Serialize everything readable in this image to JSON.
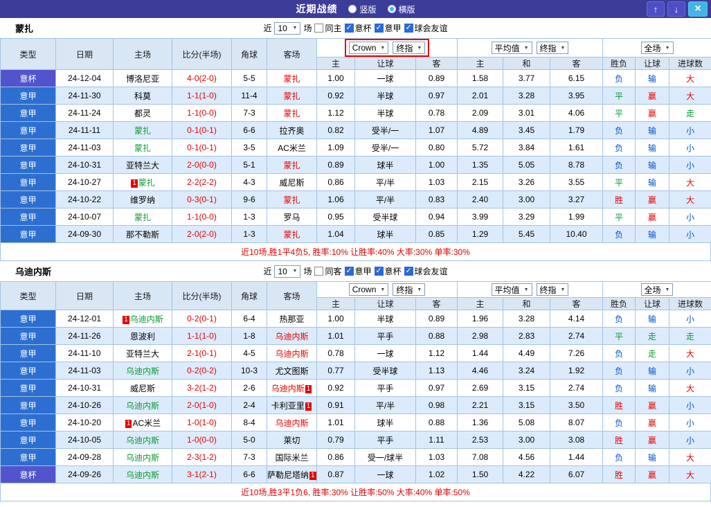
{
  "top_bar": {
    "title": "近期战绩",
    "radios": [
      {
        "label": "竖版",
        "selected": false
      },
      {
        "label": "横版",
        "selected": true
      }
    ]
  },
  "icons": {
    "caret": "▼",
    "up": "↑",
    "down": "↓",
    "close": "×",
    "check": "✓"
  },
  "colors": {
    "league_bg": "#2d6fd1",
    "cup_bg": "#5254ce",
    "win_red": "#e60000",
    "lose_blue": "#0052cc",
    "draw_green": "#0a9a32",
    "topbar_bg": "#3c3c99"
  },
  "columns": [
    "类型",
    "日期",
    "主场",
    "比分(半场)",
    "角球",
    "客场",
    "主",
    "让球",
    "客",
    "主",
    "和",
    "客",
    "胜负",
    "让球",
    "进球数"
  ],
  "sections": [
    {
      "team": "蒙扎",
      "filter": {
        "near": "近",
        "count": "10",
        "games": "场",
        "same": {
          "label": "同主",
          "checked": false
        },
        "comps": [
          {
            "label": "意杯",
            "checked": true
          },
          {
            "label": "意甲",
            "checked": true
          },
          {
            "label": "球会友谊",
            "checked": true
          }
        ]
      },
      "dropdowns": {
        "company": "Crown",
        "index1": "终指",
        "average": "平均值",
        "index2": "终指",
        "scope": "全场",
        "highlight": true
      },
      "rows": [
        {
          "comp": "意杯",
          "date": "24-12-04",
          "home": "博洛尼亚",
          "score": "4-0(2-0)",
          "corners": "5-5",
          "away": "蒙扎",
          "away_color": "red",
          "o1": "1.00",
          "line": "一球",
          "o2": "0.89",
          "e1": "1.58",
          "e2": "3.77",
          "e3": "6.15",
          "r1": "负",
          "r1_color": "blue",
          "r2": "输",
          "r2_color": "blue",
          "r3": "大",
          "r3_color": "red"
        },
        {
          "comp": "意甲",
          "date": "24-11-30",
          "home": "科莫",
          "score": "1-1(1-0)",
          "corners": "11-4",
          "away": "蒙扎",
          "away_color": "red",
          "o1": "0.92",
          "line": "半球",
          "o2": "0.97",
          "e1": "2.01",
          "e2": "3.28",
          "e3": "3.95",
          "r1": "平",
          "r1_color": "green",
          "r2": "赢",
          "r2_color": "red",
          "r3": "大",
          "r3_color": "red"
        },
        {
          "comp": "意甲",
          "date": "24-11-24",
          "home": "都灵",
          "score": "1-1(0-0)",
          "corners": "7-3",
          "away": "蒙扎",
          "away_color": "red",
          "o1": "1.12",
          "line": "半球",
          "o2": "0.78",
          "e1": "2.09",
          "e2": "3.01",
          "e3": "4.06",
          "r1": "平",
          "r1_color": "green",
          "r2": "赢",
          "r2_color": "red",
          "r3": "走",
          "r3_color": "green"
        },
        {
          "comp": "意甲",
          "date": "24-11-11",
          "home": "蒙扎",
          "home_color": "green",
          "score": "0-1(0-1)",
          "corners": "6-6",
          "away": "拉齐奥",
          "o1": "0.82",
          "line": "受半/一",
          "o2": "1.07",
          "e1": "4.89",
          "e2": "3.45",
          "e3": "1.79",
          "r1": "负",
          "r1_color": "blue",
          "r2": "输",
          "r2_color": "blue",
          "r3": "小",
          "r3_color": "blue"
        },
        {
          "comp": "意甲",
          "date": "24-11-03",
          "home": "蒙扎",
          "home_color": "green",
          "score": "0-1(0-1)",
          "corners": "3-5",
          "away": "AC米兰",
          "o1": "1.09",
          "line": "受半/一",
          "o2": "0.80",
          "e1": "5.72",
          "e2": "3.84",
          "e3": "1.61",
          "r1": "负",
          "r1_color": "blue",
          "r2": "输",
          "r2_color": "blue",
          "r3": "小",
          "r3_color": "blue"
        },
        {
          "comp": "意甲",
          "date": "24-10-31",
          "home": "亚特兰大",
          "score": "2-0(0-0)",
          "corners": "5-1",
          "away": "蒙扎",
          "away_color": "red",
          "o1": "0.89",
          "line": "球半",
          "o2": "1.00",
          "e1": "1.35",
          "e2": "5.05",
          "e3": "8.78",
          "r1": "负",
          "r1_color": "blue",
          "r2": "输",
          "r2_color": "blue",
          "r3": "小",
          "r3_color": "blue"
        },
        {
          "comp": "意甲",
          "date": "24-10-27",
          "home": "蒙扎",
          "home_color": "green",
          "home_badge_pre": "1",
          "score": "2-2(2-2)",
          "corners": "4-3",
          "away": "威尼斯",
          "o1": "0.86",
          "line": "平/半",
          "o2": "1.03",
          "e1": "2.15",
          "e2": "3.26",
          "e3": "3.55",
          "r1": "平",
          "r1_color": "green",
          "r2": "输",
          "r2_color": "blue",
          "r3": "大",
          "r3_color": "red"
        },
        {
          "comp": "意甲",
          "date": "24-10-22",
          "home": "维罗纳",
          "score": "0-3(0-1)",
          "corners": "9-6",
          "away": "蒙扎",
          "away_color": "red",
          "o1": "1.06",
          "line": "平/半",
          "o2": "0.83",
          "e1": "2.40",
          "e2": "3.00",
          "e3": "3.27",
          "r1": "胜",
          "r1_color": "red",
          "r2": "赢",
          "r2_color": "red",
          "r3": "大",
          "r3_color": "red"
        },
        {
          "comp": "意甲",
          "date": "24-10-07",
          "home": "蒙扎",
          "home_color": "green",
          "score": "1-1(0-0)",
          "corners": "1-3",
          "away": "罗马",
          "o1": "0.95",
          "line": "受半球",
          "o2": "0.94",
          "e1": "3.99",
          "e2": "3.29",
          "e3": "1.99",
          "r1": "平",
          "r1_color": "green",
          "r2": "赢",
          "r2_color": "red",
          "r3": "小",
          "r3_color": "blue"
        },
        {
          "comp": "意甲",
          "date": "24-09-30",
          "home": "那不勒斯",
          "score": "2-0(2-0)",
          "corners": "1-3",
          "away": "蒙扎",
          "away_color": "red",
          "o1": "1.04",
          "line": "球半",
          "o2": "0.85",
          "e1": "1.29",
          "e2": "5.45",
          "e3": "10.40",
          "r1": "负",
          "r1_color": "blue",
          "r2": "输",
          "r2_color": "blue",
          "r3": "小",
          "r3_color": "blue"
        }
      ],
      "summary": "近10场,胜1平4负5, 胜率:10% 让胜率:40% 大率:30% 单率:30%"
    },
    {
      "team": "乌迪内斯",
      "filter": {
        "near": "近",
        "count": "10",
        "games": "场",
        "same": {
          "label": "同客",
          "checked": false
        },
        "comps": [
          {
            "label": "意甲",
            "checked": true
          },
          {
            "label": "意杯",
            "checked": true
          },
          {
            "label": "球会友谊",
            "checked": true
          }
        ]
      },
      "dropdowns": {
        "company": "Crown",
        "index1": "终指",
        "average": "平均值",
        "index2": "终指",
        "scope": "全场",
        "highlight": false
      },
      "rows": [
        {
          "comp": "意甲",
          "date": "24-12-01",
          "home": "乌迪内斯",
          "home_color": "green",
          "home_badge_pre": "1",
          "score": "0-2(0-1)",
          "corners": "6-4",
          "away": "热那亚",
          "o1": "1.00",
          "line": "半球",
          "o2": "0.89",
          "e1": "1.96",
          "e2": "3.28",
          "e3": "4.14",
          "r1": "负",
          "r1_color": "blue",
          "r2": "输",
          "r2_color": "blue",
          "r3": "小",
          "r3_color": "blue"
        },
        {
          "comp": "意甲",
          "date": "24-11-26",
          "home": "恩波利",
          "score": "1-1(1-0)",
          "corners": "1-8",
          "away": "乌迪内斯",
          "away_color": "red",
          "o1": "1.01",
          "line": "平手",
          "o2": "0.88",
          "e1": "2.98",
          "e2": "2.83",
          "e3": "2.74",
          "r1": "平",
          "r1_color": "green",
          "r2": "走",
          "r2_color": "green",
          "r3": "走",
          "r3_color": "green"
        },
        {
          "comp": "意甲",
          "date": "24-11-10",
          "home": "亚特兰大",
          "score": "2-1(0-1)",
          "corners": "4-5",
          "away": "乌迪内斯",
          "away_color": "red",
          "o1": "0.78",
          "line": "一球",
          "o2": "1.12",
          "e1": "1.44",
          "e2": "4.49",
          "e3": "7.26",
          "r1": "负",
          "r1_color": "blue",
          "r2": "走",
          "r2_color": "green",
          "r3": "大",
          "r3_color": "red"
        },
        {
          "comp": "意甲",
          "date": "24-11-03",
          "home": "乌迪内斯",
          "home_color": "green",
          "score": "0-2(0-2)",
          "corners": "10-3",
          "away": "尤文图斯",
          "o1": "0.77",
          "line": "受半球",
          "o2": "1.13",
          "e1": "4.46",
          "e2": "3.24",
          "e3": "1.92",
          "r1": "负",
          "r1_color": "blue",
          "r2": "输",
          "r2_color": "blue",
          "r3": "小",
          "r3_color": "blue"
        },
        {
          "comp": "意甲",
          "date": "24-10-31",
          "home": "威尼斯",
          "score": "3-2(1-2)",
          "corners": "2-6",
          "away": "乌迪内斯",
          "away_color": "red",
          "away_badge_post": "1",
          "o1": "0.92",
          "line": "平手",
          "o2": "0.97",
          "e1": "2.69",
          "e2": "3.15",
          "e3": "2.74",
          "r1": "负",
          "r1_color": "blue",
          "r2": "输",
          "r2_color": "blue",
          "r3": "大",
          "r3_color": "red"
        },
        {
          "comp": "意甲",
          "date": "24-10-26",
          "home": "乌迪内斯",
          "home_color": "green",
          "score": "2-0(1-0)",
          "corners": "2-4",
          "away": "卡利亚里",
          "away_badge_post": "1",
          "o1": "0.91",
          "line": "平/半",
          "o2": "0.98",
          "e1": "2.21",
          "e2": "3.15",
          "e3": "3.50",
          "r1": "胜",
          "r1_color": "red",
          "r2": "赢",
          "r2_color": "red",
          "r3": "小",
          "r3_color": "blue"
        },
        {
          "comp": "意甲",
          "date": "24-10-20",
          "home": "AC米兰",
          "home_badge_pre": "1",
          "score": "1-0(1-0)",
          "corners": "8-4",
          "away": "乌迪内斯",
          "away_color": "red",
          "o1": "1.01",
          "line": "球半",
          "o2": "0.88",
          "e1": "1.36",
          "e2": "5.08",
          "e3": "8.07",
          "r1": "负",
          "r1_color": "blue",
          "r2": "赢",
          "r2_color": "red",
          "r3": "小",
          "r3_color": "blue"
        },
        {
          "comp": "意甲",
          "date": "24-10-05",
          "home": "乌迪内斯",
          "home_color": "green",
          "score": "1-0(0-0)",
          "corners": "5-0",
          "away": "莱切",
          "o1": "0.79",
          "line": "平手",
          "o2": "1.11",
          "e1": "2.53",
          "e2": "3.00",
          "e3": "3.08",
          "r1": "胜",
          "r1_color": "red",
          "r2": "赢",
          "r2_color": "red",
          "r3": "小",
          "r3_color": "blue"
        },
        {
          "comp": "意甲",
          "date": "24-09-28",
          "home": "乌迪内斯",
          "home_color": "green",
          "score": "2-3(1-2)",
          "corners": "7-3",
          "away": "国际米兰",
          "o1": "0.86",
          "line": "受一/球半",
          "o2": "1.03",
          "e1": "7.08",
          "e2": "4.56",
          "e3": "1.44",
          "r1": "负",
          "r1_color": "blue",
          "r2": "输",
          "r2_color": "blue",
          "r3": "大",
          "r3_color": "red"
        },
        {
          "comp": "意杯",
          "date": "24-09-26",
          "home": "乌迪内斯",
          "home_color": "green",
          "score": "3-1(2-1)",
          "corners": "6-6",
          "away": "萨勒尼塔纳",
          "away_badge_post": "1",
          "o1": "0.87",
          "line": "一球",
          "o2": "1.02",
          "e1": "1.50",
          "e2": "4.22",
          "e3": "6.07",
          "r1": "胜",
          "r1_color": "red",
          "r2": "赢",
          "r2_color": "red",
          "r3": "大",
          "r3_color": "red"
        }
      ],
      "summary": "近10场,胜3平1负6, 胜率:30% 让胜率:50% 大率:40% 单率:50%"
    }
  ]
}
